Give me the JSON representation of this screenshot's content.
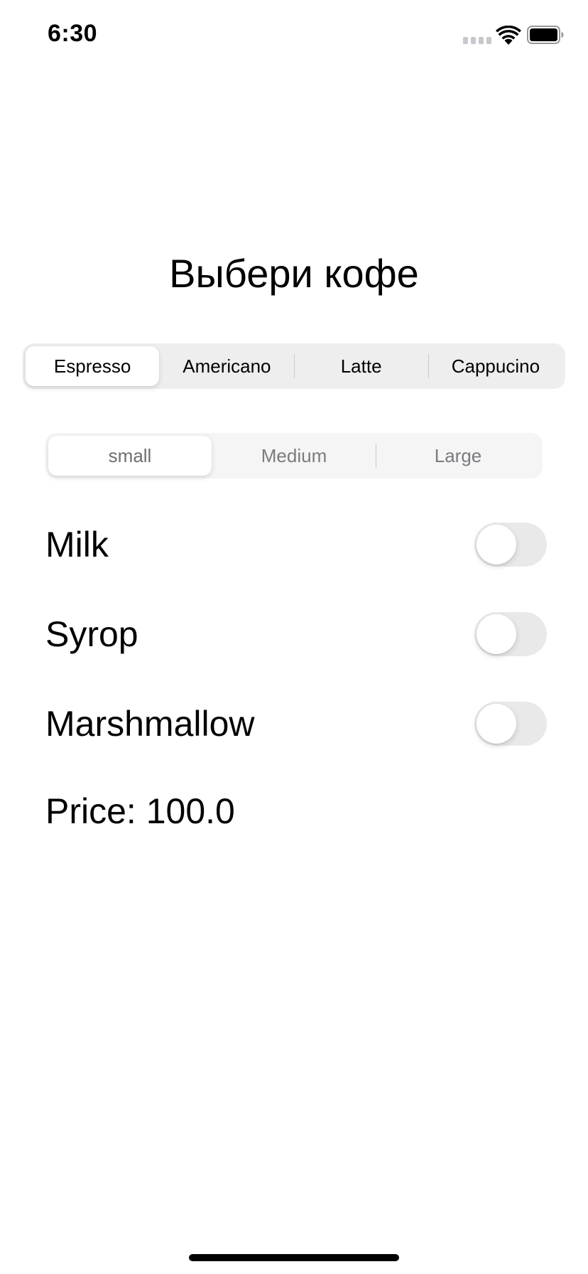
{
  "status_bar": {
    "time": "6:30",
    "icons": [
      "cellular-signal-icon",
      "wifi-icon",
      "battery-icon"
    ]
  },
  "title": "Выбери кофе",
  "coffee_selector": {
    "options": [
      "Espresso",
      "Americano",
      "Latte",
      "Cappucino"
    ],
    "selected": "Espresso"
  },
  "size_selector": {
    "options": [
      "small",
      "Medium",
      "Large"
    ],
    "selected": "small"
  },
  "options": [
    {
      "label": "Milk",
      "on": false
    },
    {
      "label": "Syrop",
      "on": false
    },
    {
      "label": "Marshmallow",
      "on": false
    }
  ],
  "price": "Price: 100.0",
  "colors": {
    "segment_bg": "#eeeeef",
    "toggle_off": "#e9e9ea",
    "text": "#000000",
    "secondary_text": "#7b7b7f"
  }
}
